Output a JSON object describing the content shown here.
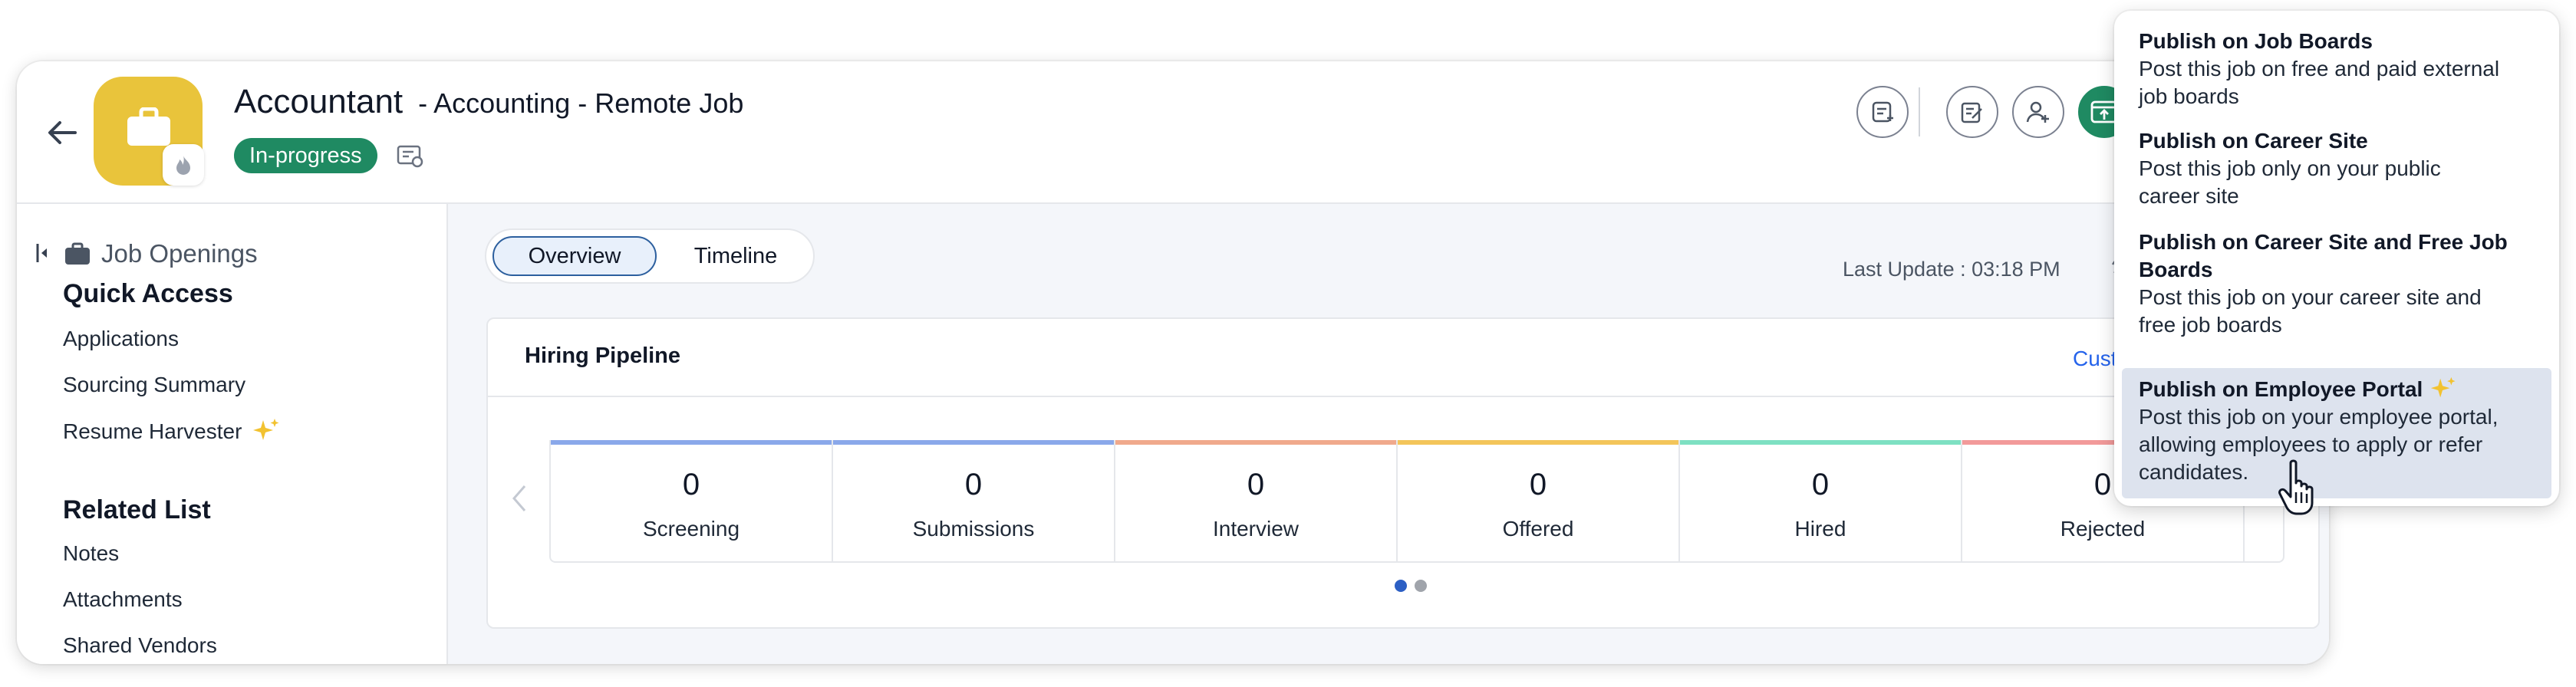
{
  "header": {
    "title": "Accountant",
    "subtitle": "- Accounting - Remote Job",
    "status": "In-progress"
  },
  "sidebar": {
    "job_openings": "Job Openings",
    "quick_access_heading": "Quick Access",
    "quick_access": [
      "Applications",
      "Sourcing Summary",
      "Resume Harvester"
    ],
    "related_list_heading": "Related List",
    "related_list": [
      "Notes",
      "Attachments",
      "Shared Vendors"
    ]
  },
  "tabs": [
    "Overview",
    "Timeline"
  ],
  "last_update": "Last Update : 03:18 PM",
  "pipeline": {
    "title": "Hiring Pipeline",
    "customize": "Custom",
    "stages": [
      {
        "count": "0",
        "label": "Screening",
        "color": "#8aa8ea"
      },
      {
        "count": "0",
        "label": "Submissions",
        "color": "#8aa8ea"
      },
      {
        "count": "0",
        "label": "Interview",
        "color": "#f0a98c"
      },
      {
        "count": "0",
        "label": "Offered",
        "color": "#f3c55a"
      },
      {
        "count": "0",
        "label": "Hired",
        "color": "#7ee0c2"
      },
      {
        "count": "0",
        "label": "Rejected",
        "color": "#f29a9a"
      }
    ]
  },
  "menu": [
    {
      "title": "Publish on Job Boards",
      "desc": [
        "Post this job on free and paid external",
        "job boards"
      ]
    },
    {
      "title": "Publish on Career Site",
      "desc": [
        "Post this job only on your public",
        "career site"
      ]
    },
    {
      "title": "Publish on Career Site and Free Job Boards",
      "title_lines": [
        "Publish on Career Site and Free Job",
        "Boards"
      ],
      "desc": [
        "Post this job on your career site and",
        "free job boards"
      ]
    },
    {
      "title": "Publish on Employee Portal",
      "desc": [
        "Post this job on your employee portal,",
        "allowing employees to apply or refer",
        "candidates."
      ]
    }
  ],
  "colors": {
    "accent_green": "#1f8a62",
    "avatar_yellow": "#e9c43b",
    "link_blue": "#2563eb",
    "sparkle": "#f2c230"
  },
  "icons": [
    "back-arrow-icon",
    "briefcase-icon",
    "flame-icon",
    "sparkle-icon",
    "eye-icon",
    "cursor-hand-icon"
  ]
}
